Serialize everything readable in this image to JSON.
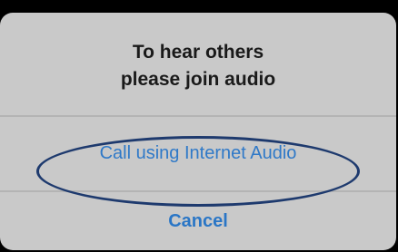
{
  "dialog": {
    "message_line1": "To hear others",
    "message_line2": "please join audio",
    "primary_action_label": "Call using Internet Audio",
    "cancel_label": "Cancel"
  },
  "colors": {
    "background": "#000000",
    "dialog_bg": "#c9c9c9",
    "accent_blue": "#2f79c8",
    "annotation_outline": "#1e3a6e"
  }
}
